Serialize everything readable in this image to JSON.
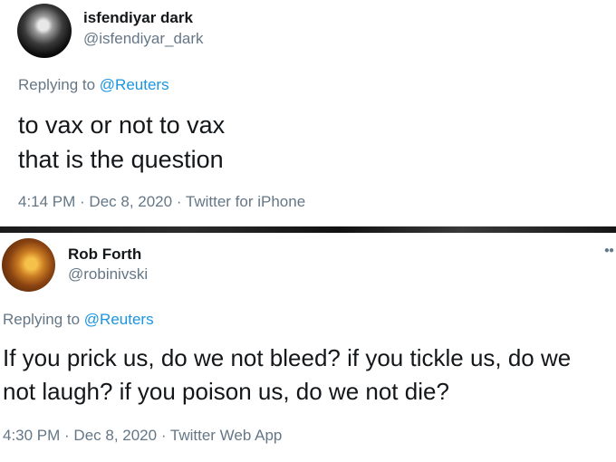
{
  "tweets": [
    {
      "display_name": "isfendiyar dark",
      "handle": "@isfendiyar_dark",
      "replying_prefix": "Replying to ",
      "replying_mention": "@Reuters",
      "text_line1": "to vax or not to vax",
      "text_line2": "that is the question",
      "meta": "4:14 PM · Dec 8, 2020 · Twitter for iPhone"
    },
    {
      "display_name": "Rob Forth",
      "handle": "@robinivski",
      "replying_prefix": "Replying to ",
      "replying_mention": "@Reuters",
      "text_line1": "If you prick us, do we not bleed? if you tickle us, do we",
      "text_line2": "not laugh? if you poison us, do we not die?",
      "meta": "4:30 PM · Dec 8, 2020 · Twitter Web App",
      "more_icon": "more-dots-icon"
    }
  ]
}
